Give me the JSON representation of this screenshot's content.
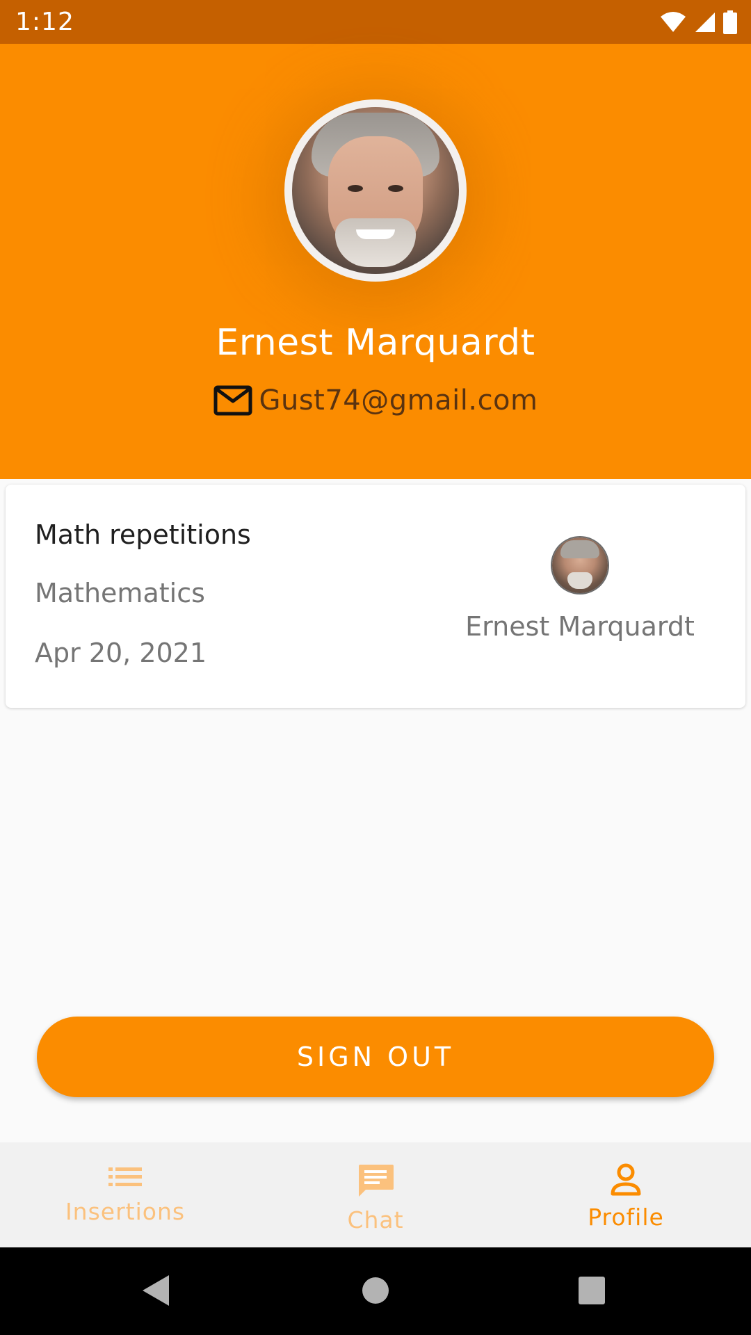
{
  "status_bar": {
    "time": "1:12",
    "icons": [
      "wifi-icon",
      "signal-icon",
      "battery-icon"
    ]
  },
  "profile": {
    "name": "Ernest Marquardt",
    "email": "Gust74@gmail.com",
    "avatar_icon": "user-photo"
  },
  "card": {
    "title": "Math repetitions",
    "subject": "Mathematics",
    "date": "Apr 20, 2021",
    "owner_name": "Ernest Marquardt"
  },
  "actions": {
    "sign_out_label": "SIGN OUT"
  },
  "bottom_nav": {
    "items": [
      {
        "label": "Insertions",
        "icon": "list-icon",
        "active": false
      },
      {
        "label": "Chat",
        "icon": "chat-icon",
        "active": false
      },
      {
        "label": "Profile",
        "icon": "person-icon",
        "active": true
      }
    ]
  },
  "system_nav": {
    "buttons": [
      "back-icon",
      "home-icon",
      "recents-icon"
    ]
  },
  "colors": {
    "primary": "#fb8c00",
    "status_bar": "#c56000",
    "inactive_nav": "#fbc17d",
    "background": "#fafafa"
  }
}
